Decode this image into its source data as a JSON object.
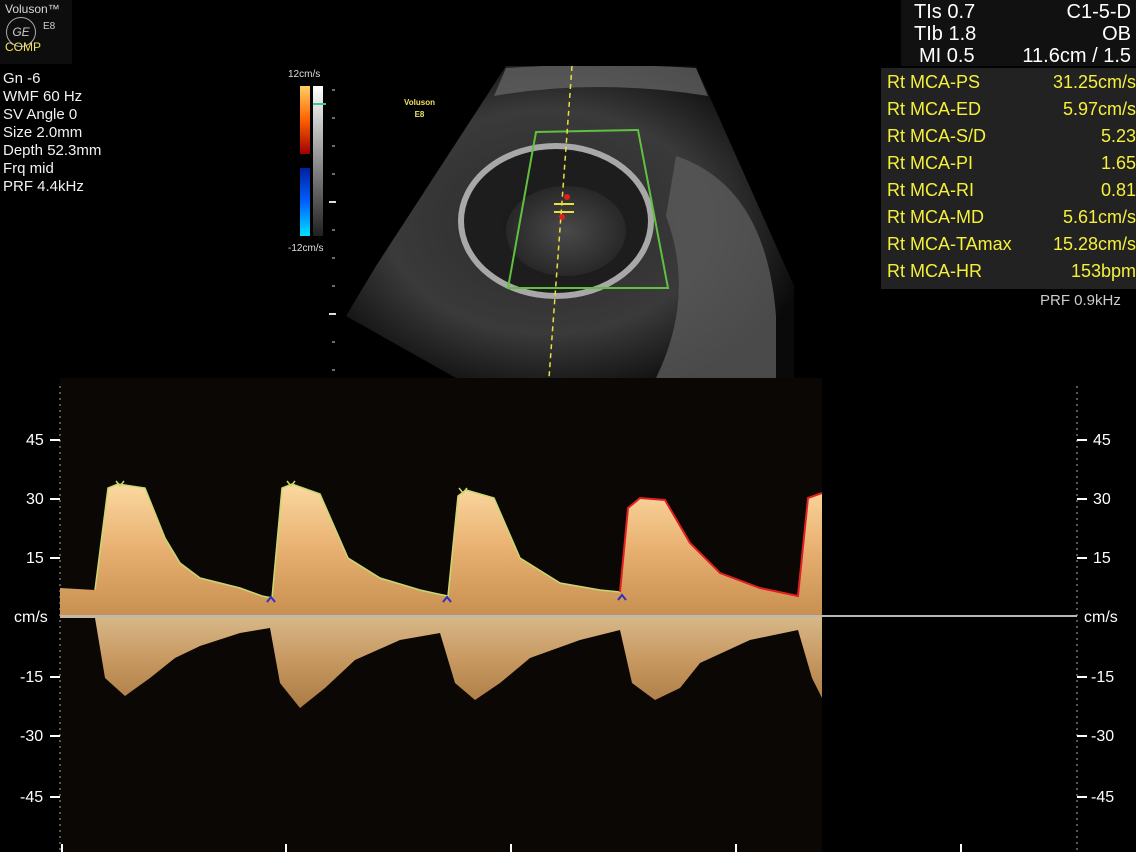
{
  "header": {
    "brand": "Voluson™",
    "logo": "GE",
    "model": "E8",
    "mode": "COMP",
    "safety": {
      "tis": "TIs 0.7",
      "tib": "TIb 1.8",
      "mi": "MI 0.5",
      "probe": "C1-5-D",
      "preset": "OB",
      "depth_freq": "11.6cm / 1.5"
    }
  },
  "params": [
    "Gn -6",
    "WMF 60 Hz",
    "SV Angle 0",
    "Size 2.0mm",
    "Depth 52.3mm",
    "Frq mid",
    "PRF 4.4kHz"
  ],
  "colorbar": {
    "top": "12cm/s",
    "bottom": "-12cm/s"
  },
  "image_watermark": {
    "line1": "Voluson",
    "line2": "E8"
  },
  "measurements": [
    {
      "label": "Rt MCA-PS",
      "value": "31.25cm/s"
    },
    {
      "label": "Rt MCA-ED",
      "value": "5.97cm/s"
    },
    {
      "label": "Rt MCA-S/D",
      "value": "5.23"
    },
    {
      "label": "Rt MCA-PI",
      "value": "1.65"
    },
    {
      "label": "Rt MCA-RI",
      "value": "0.81"
    },
    {
      "label": "Rt MCA-MD",
      "value": "5.61cm/s"
    },
    {
      "label": "Rt MCA-TAmax",
      "value": "15.28cm/s"
    },
    {
      "label": "Rt MCA-HR",
      "value": "153bpm"
    }
  ],
  "prf_right": "PRF 0.9kHz",
  "doppler": {
    "unit": "cm/s",
    "ticks": [
      "45",
      "30",
      "15",
      "-15",
      "-30",
      "-45"
    ],
    "colors": {
      "spectrum": "#f0c080",
      "trace_green": "#c8d870",
      "trace_red": "#e02020",
      "marker": "#3030c0"
    }
  }
}
